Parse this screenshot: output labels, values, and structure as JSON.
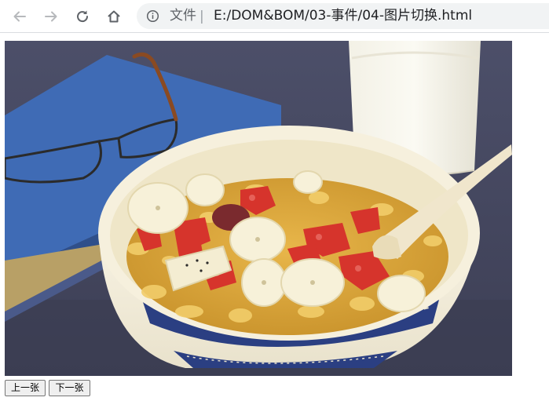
{
  "browser": {
    "address_bar": {
      "scheme_label": "文件",
      "separator": "|",
      "url": "E:/DOM&BOM/03-事件/04-图片切换.html"
    },
    "icons": [
      "back-arrow-icon",
      "forward-arrow-icon",
      "reload-icon",
      "home-icon",
      "info-icon"
    ]
  },
  "page": {
    "image": {
      "subject": "breakfast cereal bowl with banana slices and strawberries, glass of milk, glasses on a blue book"
    },
    "buttons": {
      "prev_label": "上一张",
      "next_label": "下一张"
    }
  },
  "colors": {
    "toolbar_icon": "#5f6368",
    "omnibox_bg": "#f1f3f4",
    "tablecloth": "#4a4c66",
    "book_blue": "#3f6bb5",
    "bowl_rim": "#f6f0dd",
    "bowl_pattern": "#2b3f82"
  }
}
